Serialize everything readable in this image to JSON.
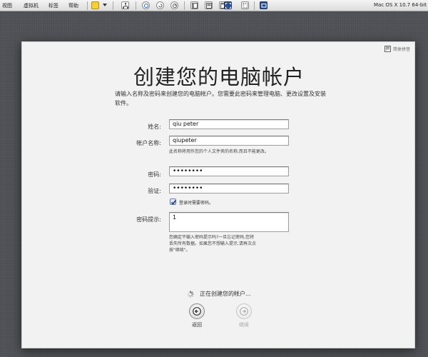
{
  "host_menu": [
    "视图",
    "虚拟机",
    "标签",
    "帮助"
  ],
  "host_title": "Mac OS X 10.7 64-bit",
  "input_source": "简体拼音",
  "title": "创建您的电脑帐户",
  "intro": "请输入名称及密码来创建您的电脑帐户。您需要此密码来管理电脑、更改设置及安装软件。",
  "form": {
    "name_label": "姓名:",
    "name_value": "qiu peter",
    "account_label": "帐户名称:",
    "account_value": "qiupeter",
    "account_note": "此名称将用作您的个人文件夹的名称,而且不能更改。",
    "password_label": "密码:",
    "password_value": "••••••••",
    "verify_label": "验证:",
    "verify_value": "••••••••",
    "require_password_label": "登录时需要密码。",
    "require_password_checked": true,
    "hint_label": "密码提示:",
    "hint_value": "1",
    "hint_note_1": "您确定不输入密码提示吗?一旦忘记密码,您将",
    "hint_note_2": "丢失所有数据。如果您不想输入提示,请再次点",
    "hint_note_3": "按\"继续\"。"
  },
  "status": "正在创建您的帐户...",
  "nav": {
    "back_label": "返回",
    "continue_label": "继续"
  },
  "colors": {
    "desktop": "#505257",
    "panel": "#f2f2f2",
    "checkbox": "#bcd0f2"
  }
}
